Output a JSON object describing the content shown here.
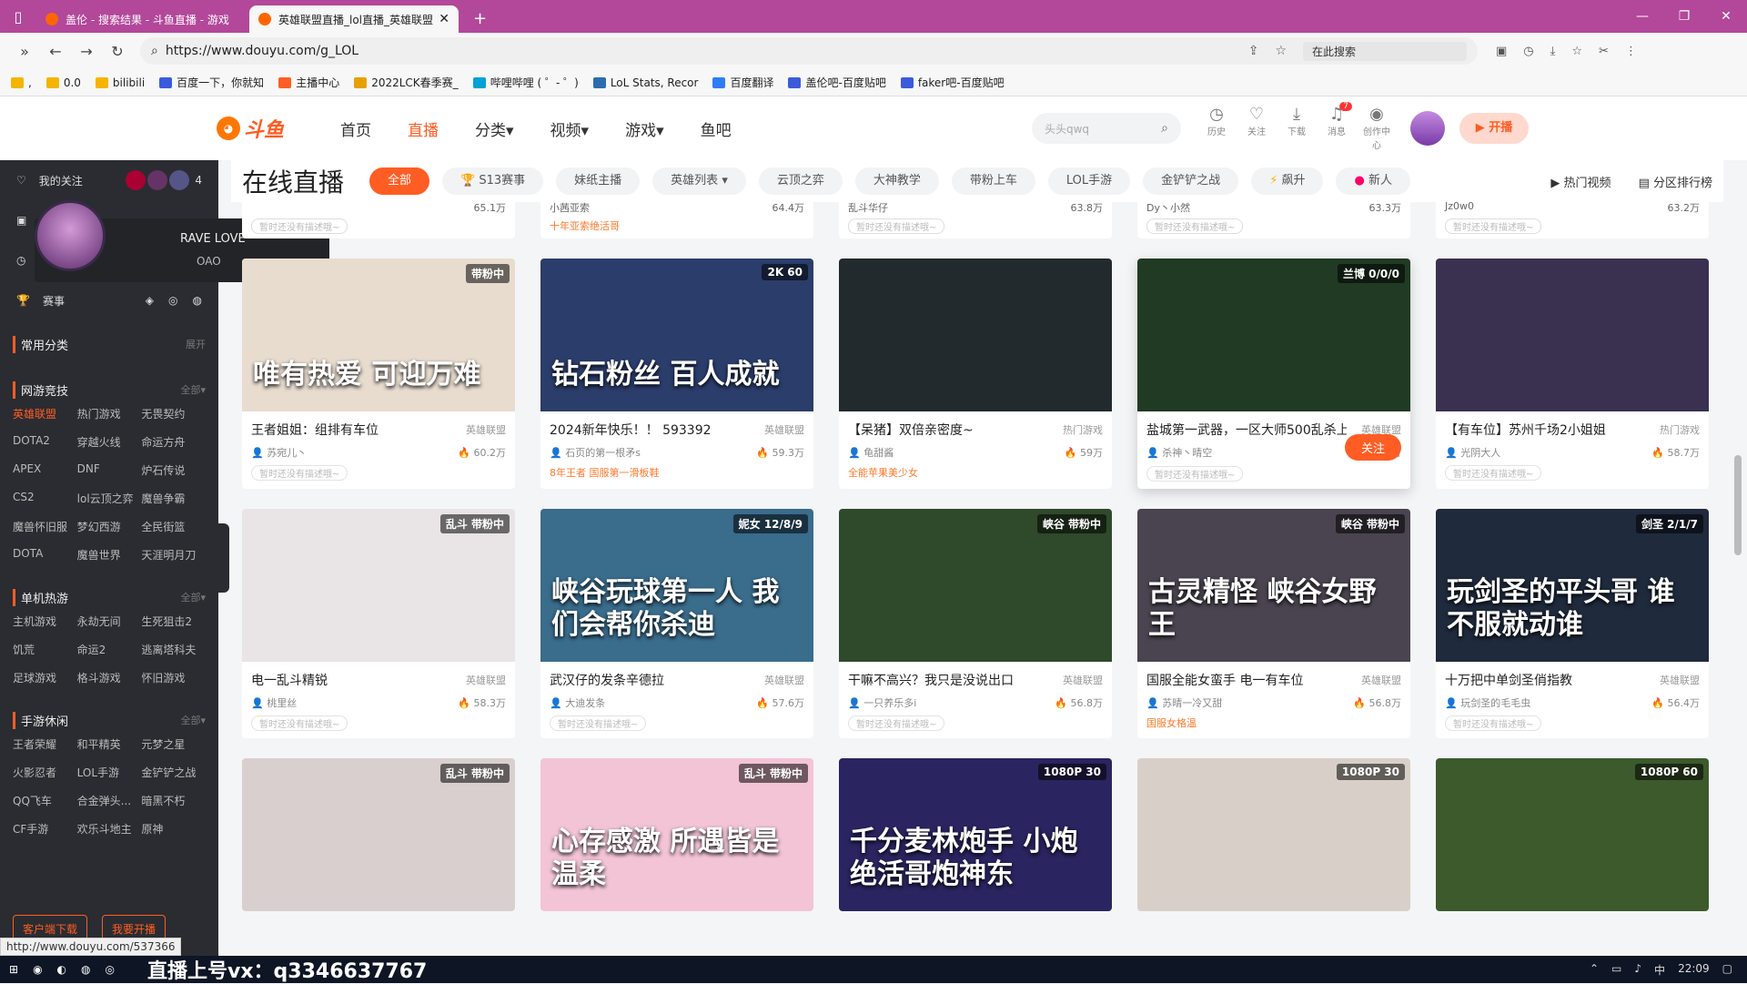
{
  "tabs": [
    {
      "label": "盖伦 - 搜索结果 - 斗鱼直播 - 游戏"
    },
    {
      "label": "英雄联盟直播_lol直播_英雄联盟"
    }
  ],
  "address": {
    "url": "https://www.douyu.com/g_LOL",
    "search_placeholder": "在此搜索"
  },
  "bookmarks": [
    "0.0",
    "bilibili",
    "百度一下，你就知",
    "主播中心",
    "2022LCK春季赛_",
    "哔哩哔哩 ( ゜- ゜)",
    "LoL Stats, Recor",
    "百度翻译",
    "盖伦吧-百度贴吧",
    "faker吧-百度贴吧"
  ],
  "header": {
    "logo_text": "斗鱼",
    "nav": [
      "首页",
      "直播",
      "分类",
      "视频",
      "游戏",
      "鱼吧"
    ],
    "search_placeholder": "头头qwq",
    "icons": [
      "历史",
      "关注",
      "下载",
      "消息",
      "创作中心"
    ],
    "message_count": "7",
    "broadcast_label": "开播"
  },
  "sidebar": {
    "follow_label": "我的关注",
    "follow_count": "4",
    "esports_label": "赛事",
    "common_label": "常用分类",
    "expand": "展开",
    "sections": [
      {
        "title": "网游竞技",
        "more": "全部",
        "items": [
          "英雄联盟",
          "热门游戏",
          "无畏契约",
          "DOTA2",
          "穿越火线",
          "命运方舟",
          "APEX",
          "DNF",
          "炉石传说",
          "CS2",
          "lol云顶之弈",
          "魔兽争霸",
          "魔兽怀旧服",
          "梦幻西游",
          "全民街篮",
          "DOTA",
          "魔兽世界",
          "天涯明月刀"
        ]
      },
      {
        "title": "单机热游",
        "more": "全部",
        "items": [
          "主机游戏",
          "永劫无间",
          "生死狙击2",
          "饥荒",
          "命运2",
          "逃离塔科夫",
          "足球游戏",
          "格斗游戏",
          "怀旧游戏"
        ]
      },
      {
        "title": "手游休闲",
        "more": "全部",
        "items": [
          "王者荣耀",
          "和平精英",
          "元梦之星",
          "火影忍者",
          "LOL手游",
          "金铲铲之战",
          "QQ飞车",
          "合金弹头...",
          "暗黑不朽",
          "CF手游",
          "欢乐斗地主",
          "原神"
        ]
      }
    ],
    "btn_client": "客户端下载",
    "btn_live": "我要开播"
  },
  "popup": {
    "name": "RAVE LOVE",
    "sub": "OAO"
  },
  "catbar": {
    "title": "在线直播",
    "pills": [
      "全部",
      "S13赛事",
      "妹纸主播",
      "英雄列表",
      "云顶之弈",
      "大神教学",
      "带粉上车",
      "LOL手游",
      "金铲铲之战",
      "飙升",
      "新人"
    ],
    "right": [
      "热门视频",
      "分区排行榜"
    ]
  },
  "top_row": [
    {
      "user": "",
      "heat": "65.1万",
      "hot": ""
    },
    {
      "user": "小茜亚索",
      "heat": "64.4万",
      "hot": "十年亚索绝活哥"
    },
    {
      "user": "乱斗华仔",
      "heat": "63.8万",
      "hot": ""
    },
    {
      "user": "Dy丶小然",
      "heat": "63.3万",
      "hot": ""
    },
    {
      "user": "Jz0w0",
      "heat": "63.2万",
      "hot": ""
    }
  ],
  "no_desc": "暂时还没有描述哦~",
  "cards": [
    {
      "title": "王者姐姐：组排有车位",
      "cat": "英雄联盟",
      "user": "苏宛儿丶",
      "heat": "60.2万",
      "badge": "带粉中",
      "cap": "唯有热爱 可迎万难",
      "hot": "",
      "bg": "#e8dccf"
    },
    {
      "title": "2024新年快乐！！ 593392",
      "cat": "英雄联盟",
      "user": "石页的第一根矛s",
      "heat": "59.3万",
      "badge": "2K 60",
      "cap": "钻石粉丝 百人成就",
      "hot": "8年王者 国服第一滑板鞋",
      "bg": "#2b3d6b"
    },
    {
      "title": "【呆猪】双倍亲密度~",
      "cat": "热门游戏",
      "user": "龟甜酱",
      "heat": "59万",
      "badge": "",
      "cap": "",
      "hot": "全能苹果美少女",
      "bg": "#222a2e"
    },
    {
      "title": "盐城第一武器，一区大师500乱杀上...",
      "cat": "英雄联盟",
      "user": "杀神丶晴空",
      "heat": "58.7万",
      "badge": "兰博 0/0/0",
      "cap": "",
      "hot": "",
      "bg": "#213a24",
      "follow": "关注"
    },
    {
      "title": "【有车位】苏州千场2小姐姐",
      "cat": "热门游戏",
      "user": "光阴大人",
      "heat": "58.7万",
      "badge": "",
      "cap": "",
      "hot": "",
      "bg": "#3a3050"
    },
    {
      "title": "电一乱斗精锐",
      "cat": "英雄联盟",
      "user": "桃里丝",
      "heat": "58.3万",
      "badge": "乱斗 带粉中",
      "cap": "",
      "hot": "",
      "bg": "#e9e4e6"
    },
    {
      "title": "武汉仔的发条辛德拉",
      "cat": "英雄联盟",
      "user": "大迪发条",
      "heat": "57.6万",
      "badge": "妮女 12/8/9",
      "cap": "峡谷玩球第一人 我们会帮你杀迪",
      "hot": "",
      "bg": "#3a6c8c"
    },
    {
      "title": "干嘛不高兴？我只是没说出口",
      "cat": "英雄联盟",
      "user": "一只养乐多i",
      "heat": "56.8万",
      "badge": "峡谷 带粉中",
      "cap": "",
      "hot": "",
      "bg": "#2f4a2a"
    },
    {
      "title": "国服全能女蛮手 电一有车位",
      "cat": "英雄联盟",
      "user": "苏晴一冷又甜",
      "heat": "56.8万",
      "badge": "峡谷 带粉中",
      "cap": "古灵精怪 峡谷女野王",
      "hot": "国服女格温",
      "bg": "#4a4450"
    },
    {
      "title": "十万把中单剑圣俏指教",
      "cat": "英雄联盟",
      "user": "玩剑圣的毛毛虫",
      "heat": "56.4万",
      "badge": "剑圣 2/1/7",
      "cap": "玩剑圣的平头哥 谁不服就动谁",
      "hot": "",
      "bg": "#1f2a3c"
    },
    {
      "title": "",
      "cat": "",
      "user": "",
      "heat": "",
      "badge": "乱斗 带粉中",
      "cap": "",
      "hot": "",
      "bg": "#d9cfcf"
    },
    {
      "title": "",
      "cat": "",
      "user": "",
      "heat": "",
      "badge": "乱斗 带粉中",
      "cap": "心存感激 所遇皆是温柔",
      "hot": "",
      "bg": "#f2c4d6"
    },
    {
      "title": "",
      "cat": "",
      "user": "",
      "heat": "",
      "badge": "1080P 30",
      "cap": "千分麦林炮手 小炮绝活哥炮神东",
      "hot": "",
      "bg": "#2a2460"
    },
    {
      "title": "",
      "cat": "",
      "user": "",
      "heat": "",
      "badge": "1080P 30",
      "cap": "",
      "hot": "",
      "bg": "#d8d0c8"
    },
    {
      "title": "",
      "cat": "",
      "user": "",
      "heat": "",
      "badge": "1080P 60",
      "cap": "",
      "hot": "",
      "bg": "#3c5a2c"
    }
  ],
  "status": {
    "url_hint": "http://www.douyu.com/537366",
    "overlay": "直播上号vx：q3346637767",
    "time": "22:09",
    "ime": "中"
  }
}
